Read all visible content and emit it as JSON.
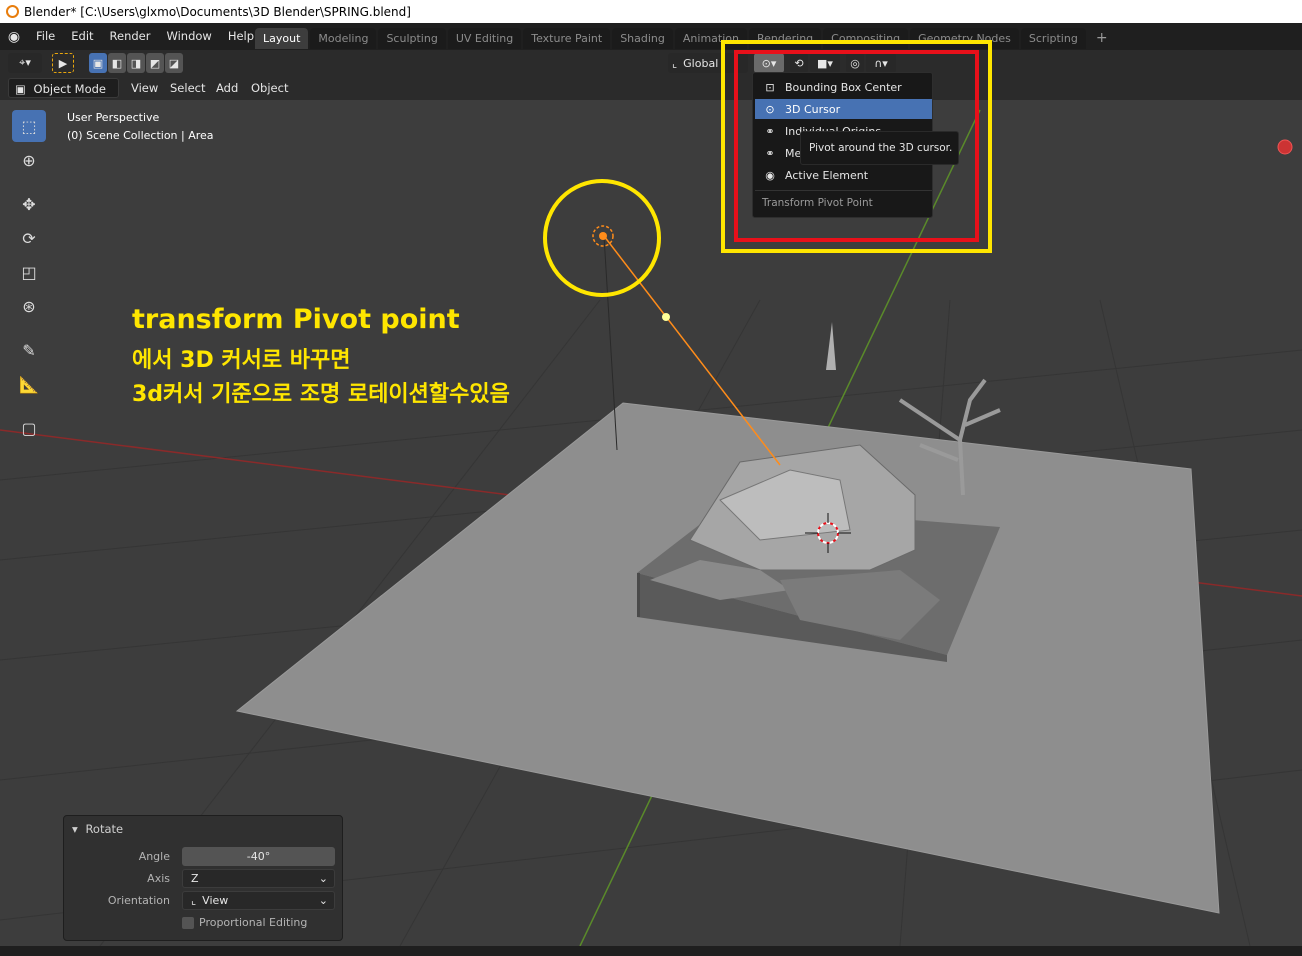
{
  "window": {
    "title": "Blender* [C:\\Users\\glxmo\\Documents\\3D Blender\\SPRING.blend]"
  },
  "menu": [
    "File",
    "Edit",
    "Render",
    "Window",
    "Help"
  ],
  "workspace_tabs": [
    "Layout",
    "Modeling",
    "Sculpting",
    "UV Editing",
    "Texture Paint",
    "Shading",
    "Animation",
    "Rendering",
    "Compositing",
    "Geometry Nodes",
    "Scripting"
  ],
  "active_tab": "Layout",
  "header": {
    "orientation_label": "Global",
    "mode": "Object Mode",
    "menus": [
      "View",
      "Select",
      "Add",
      "Object"
    ]
  },
  "viewport": {
    "perspective": "User Perspective",
    "collection": "(0) Scene Collection | Area"
  },
  "annotation": {
    "line1": "transform Pivot point",
    "line2": "에서 3D 커서로 바꾸면",
    "line3": "3d커서 기준으로 조명 로테이션할수있음"
  },
  "pivot_menu": {
    "items": [
      "Bounding Box Center",
      "3D Cursor",
      "Individual Origins",
      "Median Point",
      "Active Element"
    ],
    "selected": "3D Cursor",
    "title": "Transform Pivot Point",
    "tooltip": "Pivot around the 3D cursor."
  },
  "rotate_panel": {
    "title": "Rotate",
    "angle_label": "Angle",
    "angle_value": "-40°",
    "axis_label": "Axis",
    "axis_value": "Z",
    "orientation_label": "Orientation",
    "orientation_value": "View",
    "proportional_label": "Proportional Editing"
  },
  "colors": {
    "accent": "#4772b3",
    "highlight_yellow": "#ffe600",
    "highlight_red": "#e8101a",
    "light_orange": "#ff8c1a"
  }
}
